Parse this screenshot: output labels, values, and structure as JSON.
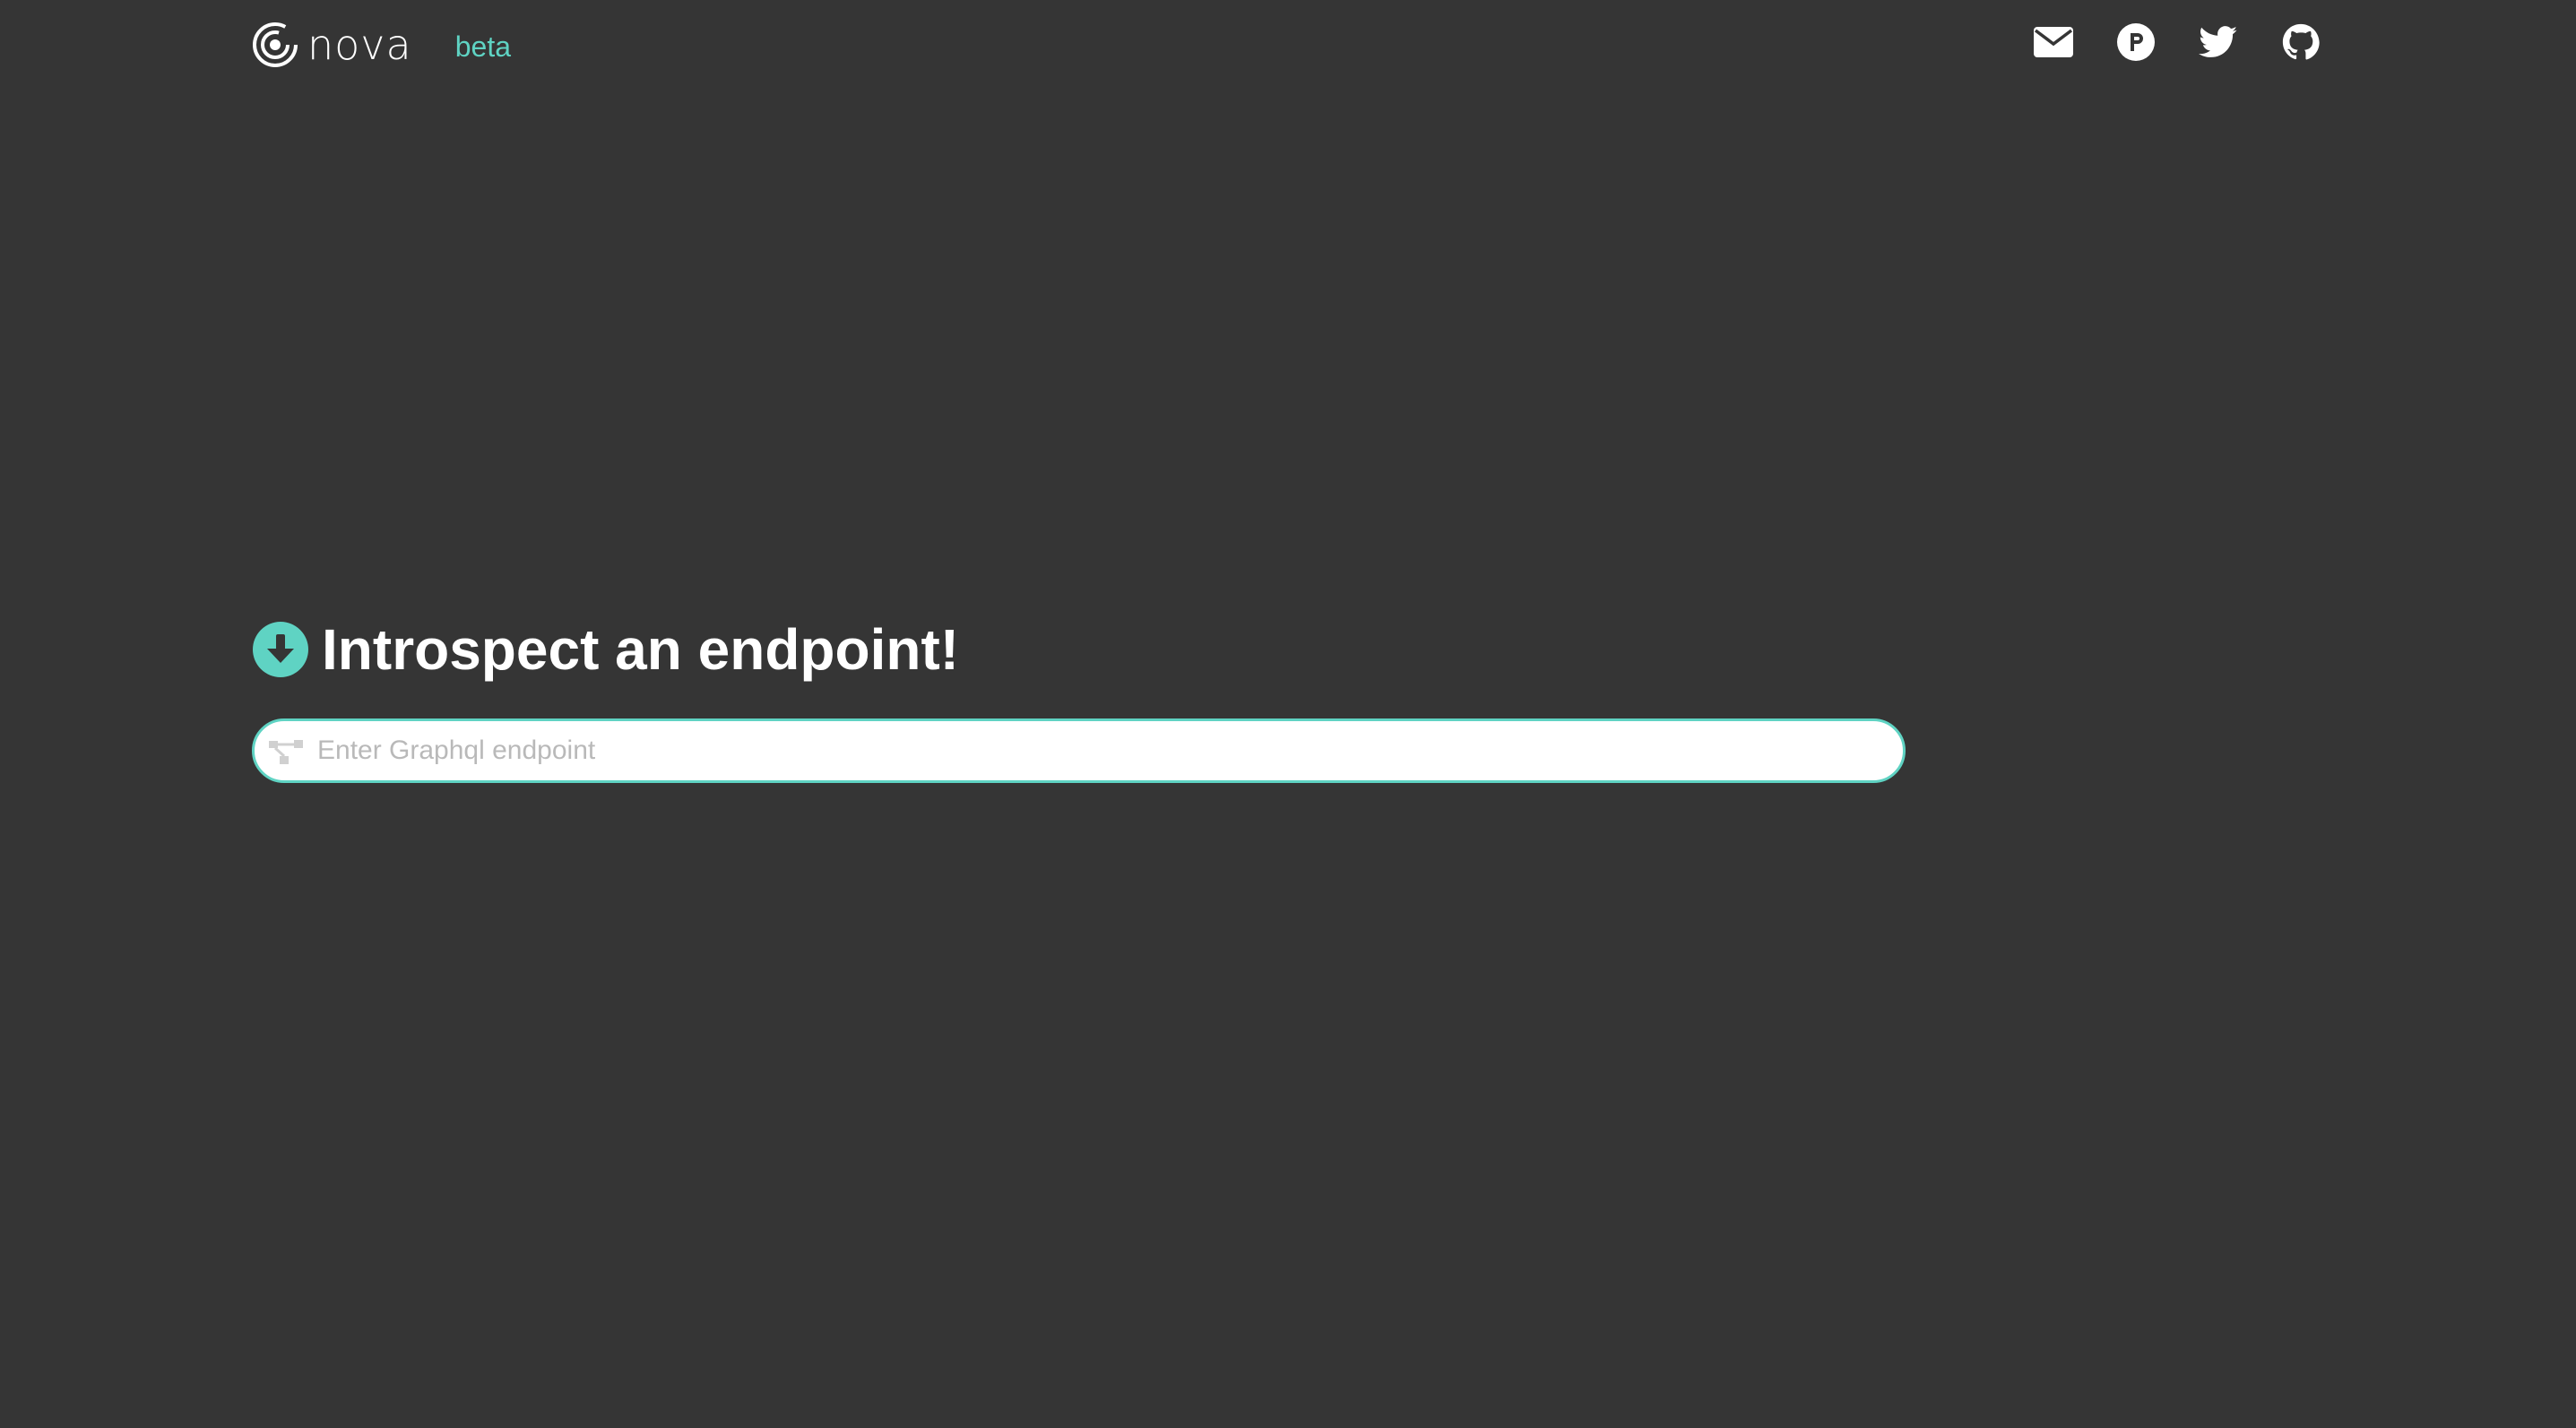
{
  "header": {
    "brand_name": "nova",
    "badge": "beta",
    "social": [
      {
        "icon": "envelope-icon"
      },
      {
        "icon": "producthunt-icon"
      },
      {
        "icon": "twitter-icon"
      },
      {
        "icon": "github-icon"
      }
    ]
  },
  "main": {
    "title": "Introspect an endpoint!",
    "title_icon": "arrow-circle-down-icon",
    "search": {
      "placeholder": "Enter Graphql endpoint",
      "value": "",
      "icon": "graph-network-icon"
    }
  },
  "colors": {
    "background": "#353535",
    "accent": "#5fd3c3",
    "text": "#ffffff"
  }
}
